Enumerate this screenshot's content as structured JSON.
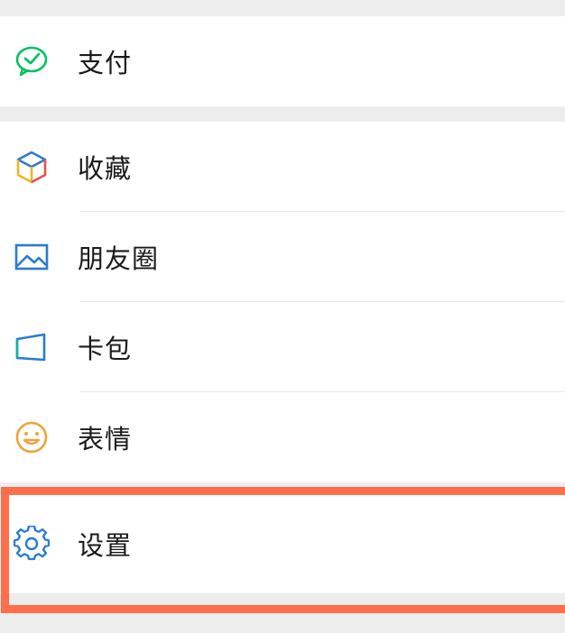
{
  "menu": {
    "pay": {
      "label": "支付",
      "icon": "wechat-pay-icon",
      "color": "#07c160"
    },
    "favorites": {
      "label": "收藏",
      "icon": "cube-icon"
    },
    "moments": {
      "label": "朋友圈",
      "icon": "image-icon",
      "color": "#2a7bd1"
    },
    "cards": {
      "label": "卡包",
      "icon": "card-icon",
      "color": "#2a7bd1"
    },
    "stickers": {
      "label": "表情",
      "icon": "smiley-icon",
      "color": "#f0a33b"
    },
    "settings": {
      "label": "设置",
      "icon": "gear-icon",
      "color": "#2a7bd1"
    }
  },
  "highlight_color": "#ff6e4a"
}
